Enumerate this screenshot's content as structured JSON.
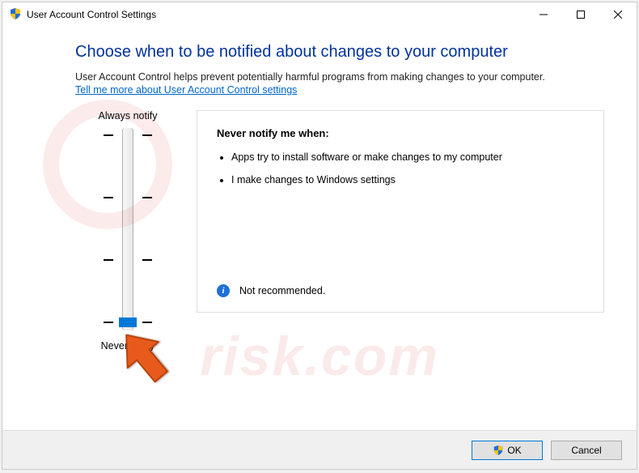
{
  "titlebar": {
    "icon": "shield-icon",
    "title": "User Account Control Settings"
  },
  "page": {
    "heading": "Choose when to be notified about changes to your computer",
    "subtext": "User Account Control helps prevent potentially harmful programs from making changes to your computer.",
    "help_link": "Tell me more about User Account Control settings"
  },
  "slider": {
    "top_label": "Always notify",
    "bottom_label": "Never notify",
    "levels": 4,
    "current_level": 0
  },
  "description": {
    "title": "Never notify me when:",
    "bullets": [
      "Apps try to install software or make changes to my computer",
      "I make changes to Windows settings"
    ],
    "status_icon": "info-icon",
    "status_text": "Not recommended."
  },
  "footer": {
    "ok_label": "OK",
    "cancel_label": "Cancel"
  },
  "watermark": {
    "text": "risk.com"
  }
}
